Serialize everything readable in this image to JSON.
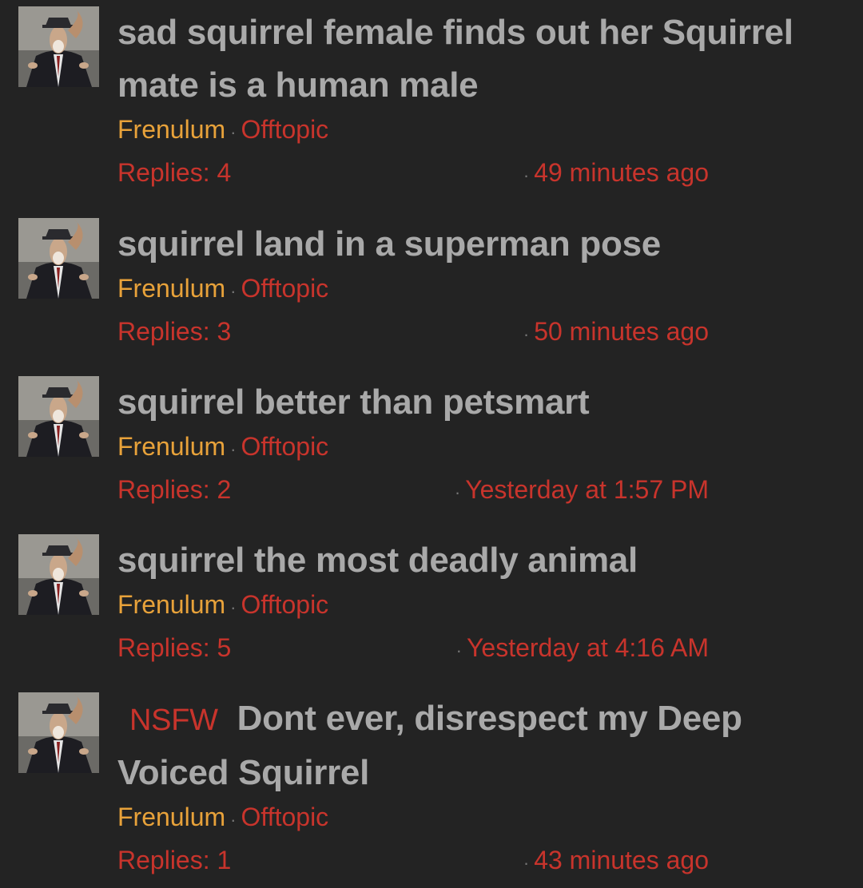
{
  "threads": [
    {
      "title": "sad squirrel female finds out her Squirrel mate is a human male",
      "author": "Frenulum",
      "forum": "Offtopic",
      "replies": "Replies: 4",
      "time": "49 minutes ago",
      "nsfw": ""
    },
    {
      "title": "squirrel land in a superman pose",
      "author": "Frenulum",
      "forum": "Offtopic",
      "replies": "Replies: 3",
      "time": "50 minutes ago",
      "nsfw": ""
    },
    {
      "title": "squirrel better than petsmart",
      "author": "Frenulum",
      "forum": "Offtopic",
      "replies": "Replies: 2",
      "time": "Yesterday at 1:57 PM",
      "nsfw": ""
    },
    {
      "title": "squirrel the most deadly animal",
      "author": "Frenulum",
      "forum": "Offtopic",
      "replies": "Replies: 5",
      "time": "Yesterday at 4:16 AM",
      "nsfw": ""
    },
    {
      "title": "Dont ever, disrespect my Deep Voiced Squirrel",
      "author": "Frenulum",
      "forum": "Offtopic",
      "replies": "Replies: 1",
      "time": "43 minutes ago",
      "nsfw": "NSFW"
    }
  ],
  "separator": "·",
  "colors": {
    "background": "#232323",
    "title": "#a9a9a9",
    "author": "#e8a23a",
    "accent_red": "#c8342c"
  },
  "icons": {
    "avatar": "squirrel-in-suit-avatar"
  }
}
